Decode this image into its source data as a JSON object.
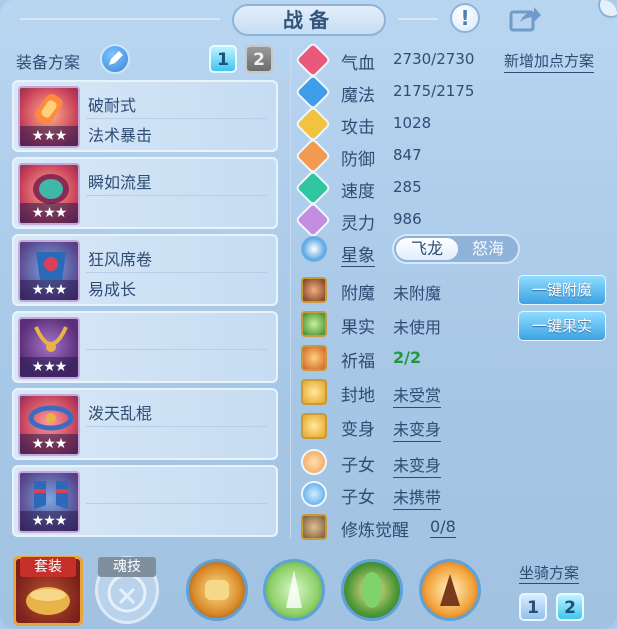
{
  "header": {
    "title": "战备"
  },
  "equipment": {
    "plan_label": "装备方案",
    "plan_numbers": [
      "1",
      "2"
    ],
    "stars": "★★★",
    "items": [
      {
        "name": "破耐式",
        "sub": "法术暴击",
        "icon": "popsicle-icon"
      },
      {
        "name": "瞬如流星",
        "sub": "",
        "icon": "helmet-icon"
      },
      {
        "name": "狂风席卷",
        "sub": "易成长",
        "icon": "armor-icon"
      },
      {
        "name": "",
        "sub": "",
        "icon": "necklace-icon"
      },
      {
        "name": "泼天乱棍",
        "sub": "",
        "icon": "belt-icon"
      },
      {
        "name": "",
        "sub": "",
        "icon": "boots-icon"
      }
    ]
  },
  "stats": {
    "add_plan": "新增加点方案",
    "items": [
      {
        "label": "气血",
        "value": "2730/2730",
        "color": "#e9577a",
        "icon": "heart-icon"
      },
      {
        "label": "魔法",
        "value": "2175/2175",
        "color": "#3f9ee8",
        "icon": "mana-icon"
      },
      {
        "label": "攻击",
        "value": "1028",
        "color": "#f2c340",
        "icon": "sword-icon"
      },
      {
        "label": "防御",
        "value": "847",
        "color": "#f29a52",
        "icon": "shield-icon"
      },
      {
        "label": "速度",
        "value": "285",
        "color": "#2fc6a0",
        "icon": "speed-icon"
      },
      {
        "label": "灵力",
        "value": "986",
        "color": "#c58de0",
        "icon": "spirit-icon"
      }
    ],
    "star_label": "星象",
    "star_options": [
      "飞龙",
      "怒海"
    ]
  },
  "attributes": [
    {
      "label": "附魔",
      "value": "未附魔",
      "underline": false,
      "green": false,
      "icon": "enchant-icon",
      "color": "#7a3a1e"
    },
    {
      "label": "果实",
      "value": "未使用",
      "underline": false,
      "green": false,
      "icon": "fruit-icon",
      "color": "#3f8a2f"
    },
    {
      "label": "祈福",
      "value": "2/2",
      "underline": false,
      "green": true,
      "icon": "blessing-icon",
      "color": "#d0602a"
    },
    {
      "label": "封地",
      "value": "未受赏",
      "underline": true,
      "green": false,
      "icon": "fief-icon",
      "color": "#e6a525"
    },
    {
      "label": "变身",
      "value": "未变身",
      "underline": true,
      "green": false,
      "icon": "transform-icon",
      "color": "#e6a525"
    },
    {
      "label": "子女",
      "value": "未变身",
      "underline": true,
      "green": false,
      "icon": "child-icon",
      "color": "#f29a52"
    },
    {
      "label": "子女",
      "value": "未携带",
      "underline": true,
      "green": false,
      "icon": "paw-icon",
      "color": "#3f9ee8"
    },
    {
      "label": "修炼觉醒",
      "value": "0/8",
      "underline": true,
      "green": false,
      "icon": "cultivate-icon",
      "color": "#7a5a3a"
    }
  ],
  "buttons": {
    "enchant": "一键附魔",
    "fruit": "一键果实"
  },
  "bottom": {
    "suit_label": "套装",
    "soul_label": "魂技",
    "mount_plan": "坐骑方案",
    "mount_numbers": [
      "1",
      "2"
    ]
  }
}
